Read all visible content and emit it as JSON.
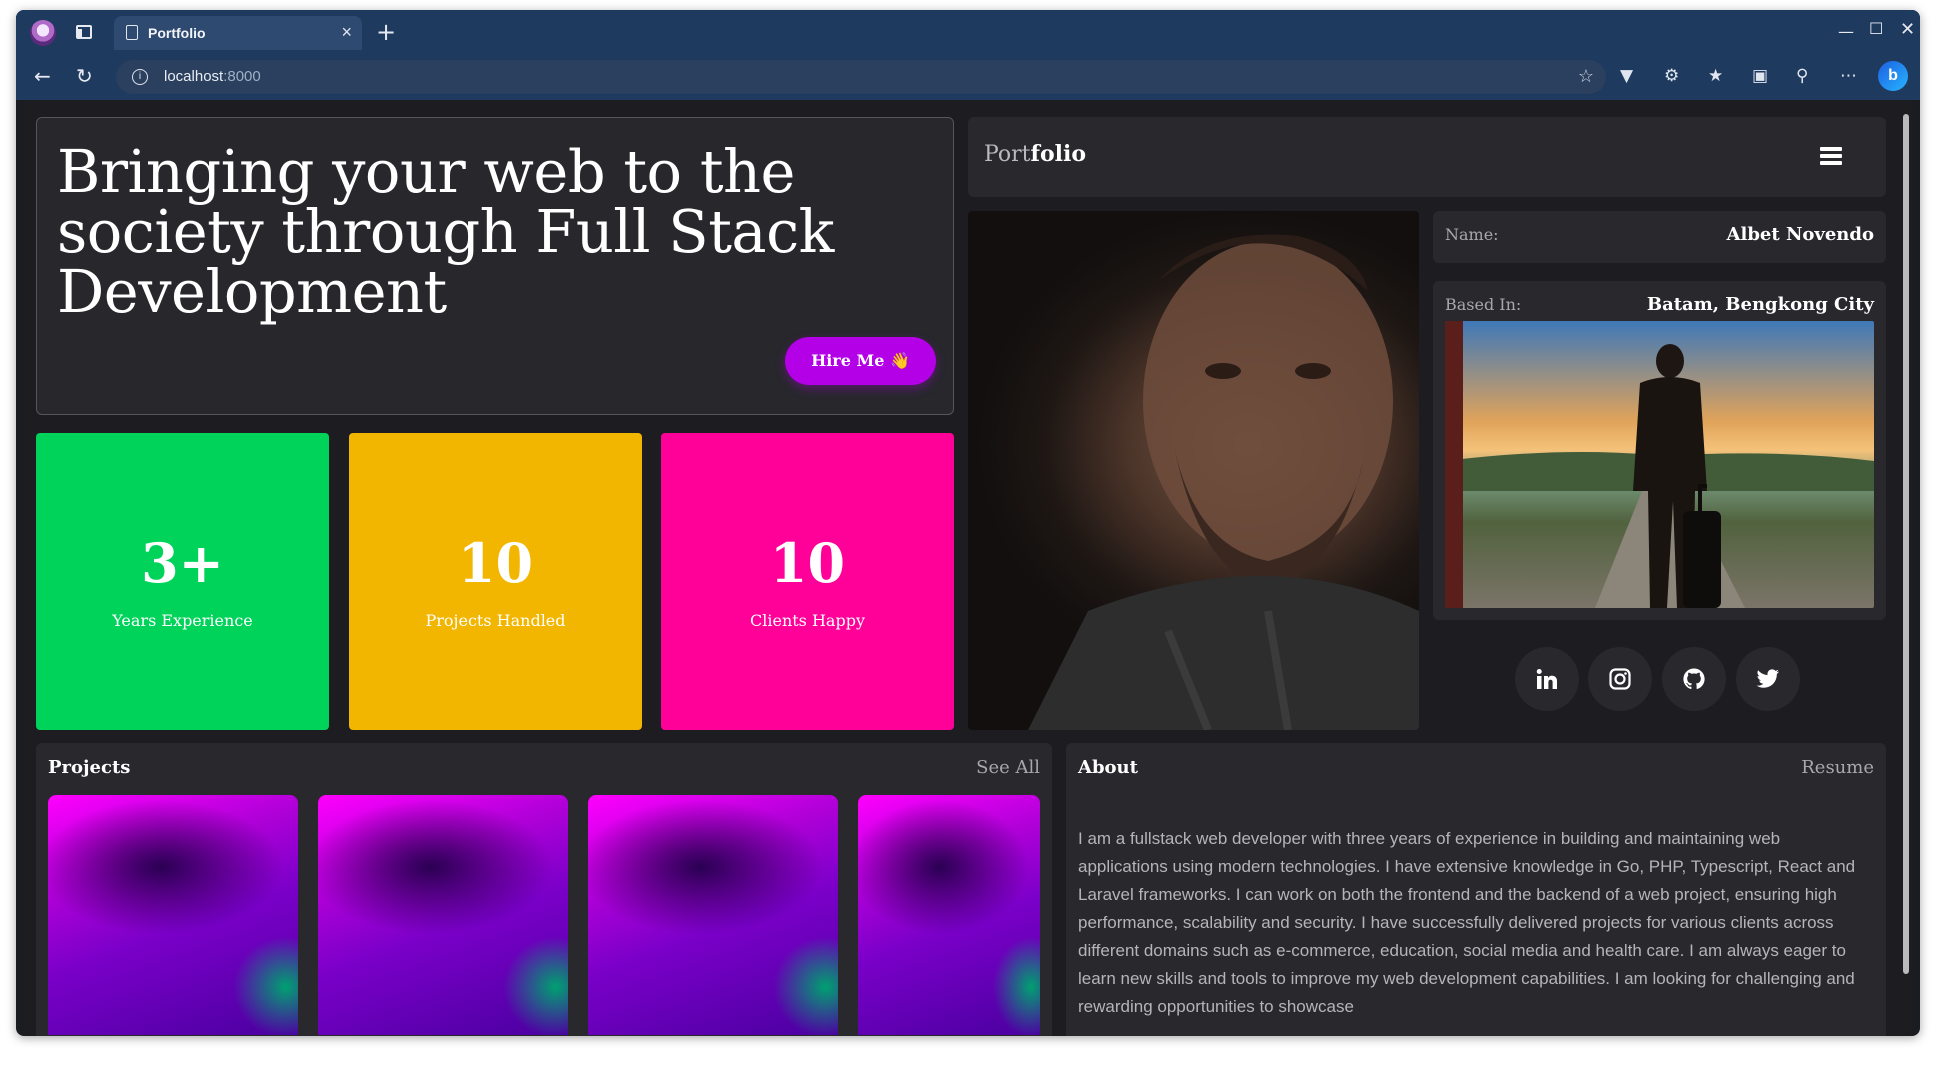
{
  "browser": {
    "tab_title": "Portfolio",
    "url_host": "localhost",
    "url_port": ":8000"
  },
  "hero": {
    "headline": "Bringing your web to the society through Full Stack Development",
    "hire_button": "Hire Me 👋"
  },
  "stats": [
    {
      "value": "3+",
      "label": "Years Experience",
      "color": "#00d35a"
    },
    {
      "value": "10",
      "label": "Projects Handled",
      "color": "#f2b500"
    },
    {
      "value": "10",
      "label": "Clients Happy",
      "color": "#ff0099"
    }
  ],
  "nav": {
    "logo_light": "Port",
    "logo_bold": "folio",
    "menu_icon": "hamburger-icon"
  },
  "profile": {
    "name_label": "Name:",
    "name_value": "Albet Novendo",
    "based_label": "Based In:",
    "based_value": "Batam, Bengkong City"
  },
  "social": [
    "linkedin-icon",
    "instagram-icon",
    "github-icon",
    "twitter-icon"
  ],
  "projects": {
    "title": "Projects",
    "link": "See All"
  },
  "about": {
    "title": "About",
    "link": "Resume",
    "text": "I am a fullstack web developer with three years of experience in building and maintaining web applications using modern technologies. I have extensive knowledge in Go, PHP, Typescript, React and Laravel frameworks. I can work on both the frontend and the backend of a web project, ensuring high performance, scalability and security. I have successfully delivered projects for various clients across different domains such as e-commerce, education, social media and health care. I am always eager to learn new skills and tools to improve my web development capabilities. I am looking for challenging and rewarding opportunities to showcase"
  },
  "colors": {
    "accent": "#b300e6",
    "background": "#1c1c21",
    "card": "#28282d"
  }
}
